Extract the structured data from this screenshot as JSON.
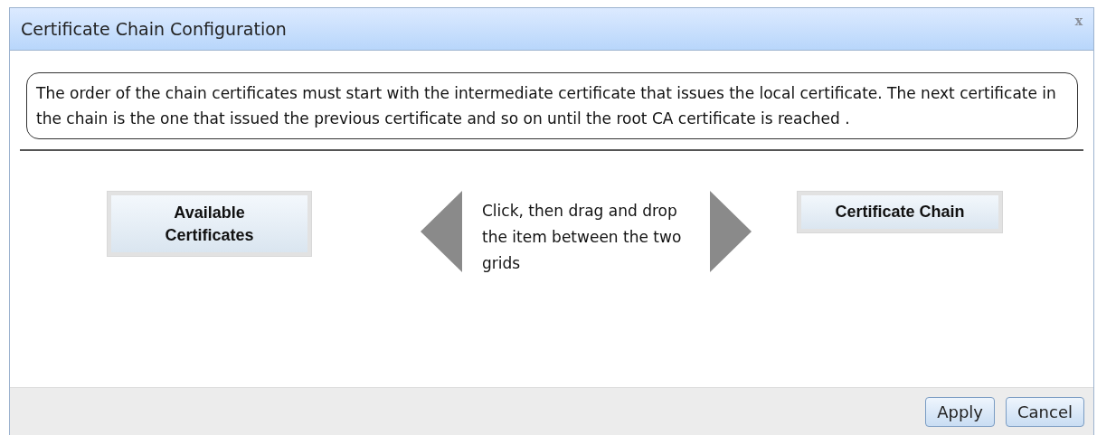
{
  "dialog": {
    "title": "Certificate Chain Configuration",
    "close": "x"
  },
  "notice": "The order of the chain certificates must start with the intermediate certificate that issues the local certificate. The next certificate in the chain is the one that issued the previous certificate and so on until the root CA certificate is reached .",
  "grids": [
    {
      "header": "Available Certificates"
    },
    {
      "header": "Certificate Chain"
    }
  ],
  "instruction": "Click, then drag and drop the item between the two grids",
  "buttons": [
    "Apply",
    "Cancel"
  ]
}
